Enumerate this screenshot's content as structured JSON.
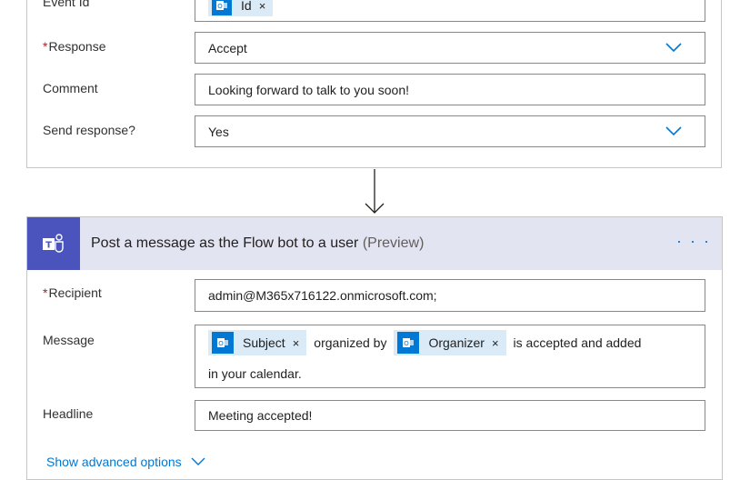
{
  "top_card": {
    "event_id_label": "Event Id",
    "event_id_token": "Id",
    "response_label": "Response",
    "response_value": "Accept",
    "comment_label": "Comment",
    "comment_value": "Looking forward to talk to you soon!",
    "send_response_label": "Send response?",
    "send_response_value": "Yes"
  },
  "action": {
    "title": "Post a message as the Flow bot to a user",
    "preview_tag": "(Preview)",
    "more_label": "· · ·",
    "recipient_label": "Recipient",
    "recipient_value": "admin@M365x716122.onmicrosoft.com;",
    "message_label": "Message",
    "message": {
      "token1": "Subject",
      "text1": "organized by",
      "token2": "Organizer",
      "text2": "is accepted and added",
      "text3": "in your calendar."
    },
    "headline_label": "Headline",
    "headline_value": "Meeting accepted!",
    "show_advanced": "Show advanced options"
  },
  "token_close": "×",
  "colors": {
    "accent": "#0078d4",
    "teams": "#4b53bc",
    "header_bg": "#e3e4f2",
    "token_bg": "#daeaf7",
    "required": "#a4262c"
  }
}
